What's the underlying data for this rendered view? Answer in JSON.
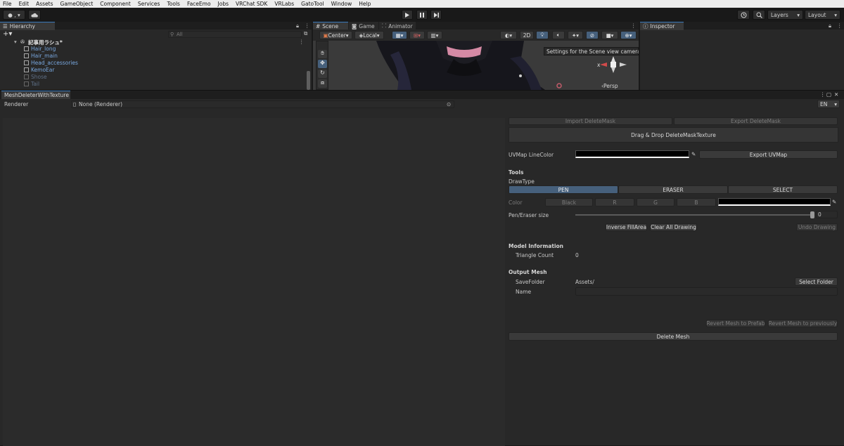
{
  "menu": [
    "File",
    "Edit",
    "Assets",
    "GameObject",
    "Component",
    "Services",
    "Tools",
    "FaceEmo",
    "Jobs",
    "VRChat SDK",
    "VRLabs",
    "GatoTool",
    "Window",
    "Help"
  ],
  "toolbar": {
    "account_label": "● ,",
    "layers_label": "Layers",
    "layout_label": "Layout"
  },
  "hierarchy": {
    "tab_label": "Hierarchy",
    "search_placeholder": "All",
    "scene_root": "記事用ラシュ*",
    "items": [
      {
        "label": "Hair_long",
        "dimmed": false
      },
      {
        "label": "Hair_main",
        "dimmed": false
      },
      {
        "label": "Head_accessories",
        "dimmed": false
      },
      {
        "label": "KemoEar",
        "dimmed": false
      },
      {
        "label": "Shose",
        "dimmed": true
      },
      {
        "label": "Tail",
        "dimmed": true
      }
    ]
  },
  "scene_view": {
    "tabs": [
      "Scene",
      "Game",
      "Animator"
    ],
    "pivot_label": "Center",
    "space_label": "Local",
    "mode_2d": "2D",
    "tooltip": "Settings for the Scene view camera.",
    "gizmo_axis": "x",
    "persp_label": "‹Persp"
  },
  "inspector": {
    "tab_label": "Inspector"
  },
  "tool_window": {
    "tab_label": "MeshDeleterWithTexture",
    "renderer_label": "Renderer",
    "renderer_value": "None (Renderer)",
    "language": "EN",
    "import_mask": "Import DeleteMask",
    "export_mask": "Export DeleteMask",
    "drop_zone": "Drag & Drop DeleteMaskTexture",
    "uv_line_color_label": "UVMap LineColor",
    "export_uv": "Export UVMap",
    "tools_header": "Tools",
    "draw_type_label": "DrawType",
    "draw_types": [
      "PEN",
      "ERASER",
      "SELECT"
    ],
    "selected_draw_type": "PEN",
    "color_label": "Color",
    "color_buttons": [
      "Black",
      "R",
      "G",
      "B"
    ],
    "pen_size_label": "Pen/Eraser size",
    "pen_size_value": "0",
    "inverse_fill": "Inverse FillArea",
    "clear_drawing": "Clear All Drawing",
    "undo_drawing": "Undo Drawing",
    "model_info_header": "Model Information",
    "triangle_count_label": "Triangle Count",
    "triangle_count_value": "0",
    "output_header": "Output Mesh",
    "save_folder_label": "SaveFolder",
    "save_folder_value": "Assets/",
    "select_folder": "Select Folder",
    "name_label": "Name",
    "name_value": "",
    "revert_prefab": "Revert Mesh to Prefab",
    "revert_previous": "Revert Mesh to previously",
    "delete_mesh": "Delete Mesh"
  },
  "colors": {
    "accent": "#3a79bb",
    "selected_button": "#46607c",
    "link_text": "#79a8e0"
  }
}
